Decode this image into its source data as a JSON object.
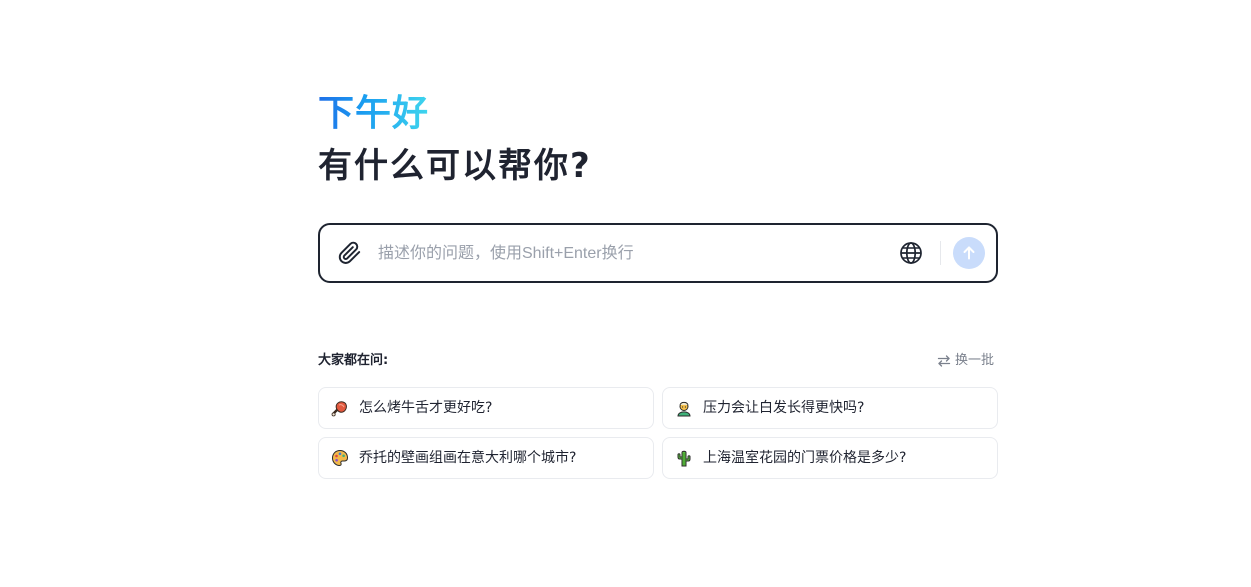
{
  "hero": {
    "greeting": "下午好",
    "headline": "有什么可以帮你?"
  },
  "composer": {
    "placeholder": "描述你的问题，使用Shift+Enter换行",
    "value": "",
    "attach_icon": "paperclip-icon",
    "web_search_icon": "globe-icon",
    "send_icon": "arrow-up-icon"
  },
  "suggestions": {
    "label": "大家都在问:",
    "refresh_label": "换一批",
    "refresh_icon": "swap-arrows-icon",
    "items": [
      {
        "text": "怎么烤牛舌才更好吃?",
        "icon": "meat-on-bone-icon"
      },
      {
        "text": "压力会让白发长得更快吗?",
        "icon": "person-icon"
      },
      {
        "text": "乔托的壁画组画在意大利哪个城市?",
        "icon": "artist-palette-icon"
      },
      {
        "text": "上海温室花园的门票价格是多少?",
        "icon": "cactus-icon"
      }
    ]
  },
  "colors": {
    "greeting_gradient": [
      "#1f6fe8",
      "#1a9cf0",
      "#3fd6ee"
    ],
    "headline": "#1f2330",
    "input_border": "#1e2430",
    "send_button_disabled": "#c9dcfb",
    "muted_text": "#7a808c"
  }
}
